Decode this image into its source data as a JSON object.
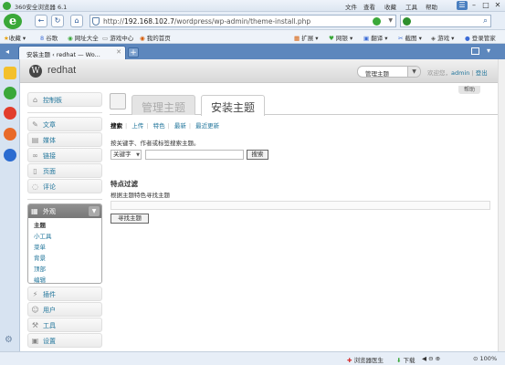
{
  "browser": {
    "title": "360安全浏览器 6.1",
    "menu": [
      "文件",
      "查看",
      "收藏",
      "工具",
      "帮助"
    ],
    "url_prefix": "http://",
    "url_host": "192.168.102.7",
    "url_path": "/wordpress/wp-admin/theme-install.php",
    "favorites": [
      "收藏",
      "谷歌",
      "网址大全",
      "游戏中心",
      "我的首页"
    ],
    "toolbar_right": [
      "扩展",
      "网银",
      "翻译",
      "截图",
      "游戏",
      "登录管家"
    ],
    "tab_label": "安装主题 ‹ redhat — Wo...",
    "status": [
      "浏览器医生",
      "下载",
      "100%"
    ]
  },
  "wp": {
    "site_name": "redhat",
    "favorite_actions": "管理主题",
    "howdy": "欢迎您，",
    "user": "admin",
    "logout": "登出",
    "help": "帮助",
    "menu": {
      "dashboard": "控制板",
      "posts": "文章",
      "media": "媒体",
      "links": "链接",
      "pages": "页面",
      "comments": "评论",
      "appearance": "外观",
      "appearance_sub": [
        "主题",
        "小工具",
        "菜单",
        "背景",
        "顶部",
        "编辑"
      ],
      "plugins": "插件",
      "users": "用户",
      "tools": "工具",
      "settings": "设置"
    },
    "tabs": [
      "管理主题",
      "安装主题"
    ],
    "subsub": [
      "搜索",
      "上传",
      "特色",
      "最新",
      "最近更新"
    ],
    "intro": "按关键字、作者或标签搜索主题。",
    "search_type": "关键字",
    "search_button": "搜索",
    "filter_title": "特点过滤",
    "filter_desc": "根据主题特色寻找主题",
    "find_button": "寻找主题"
  }
}
